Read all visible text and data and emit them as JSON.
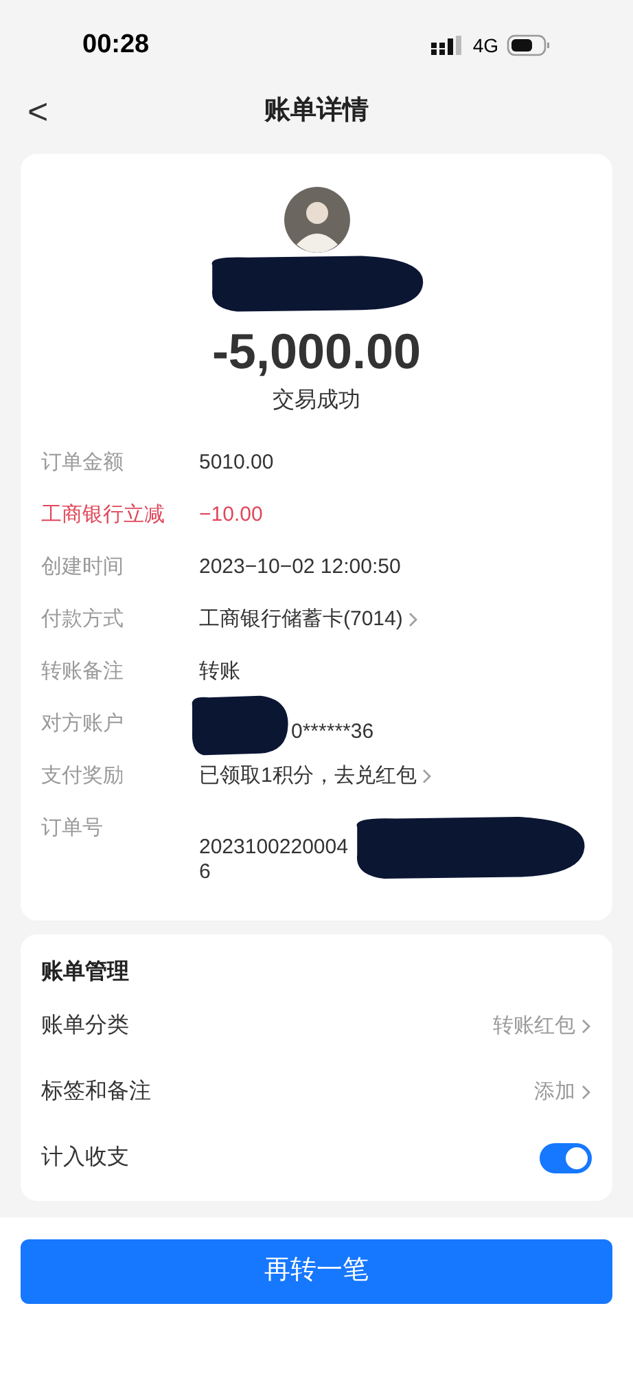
{
  "status_bar": {
    "time": "00:28",
    "network": "4G"
  },
  "header": {
    "title": "账单详情",
    "back": "<"
  },
  "summary": {
    "amount": "-5,000.00",
    "status": "交易成功"
  },
  "details": [
    {
      "label": "订单金额",
      "value": "5010.00",
      "kind": "plain"
    },
    {
      "label": "工商银行立减",
      "value": "−10.00",
      "kind": "discount"
    },
    {
      "label": "创建时间",
      "value": "2023−10−02 12:00:50",
      "kind": "plain"
    },
    {
      "label": "付款方式",
      "value": "工商银行储蓄卡(7014)",
      "kind": "link"
    },
    {
      "label": "转账备注",
      "value": "转账",
      "kind": "plain"
    },
    {
      "label": "对方账户",
      "value": "0******36",
      "kind": "redacted"
    },
    {
      "label": "支付奖励",
      "value": "已领取1积分，去兑红包",
      "kind": "link"
    },
    {
      "label": "订单号",
      "value": "2023100220004",
      "value_line_2": "6",
      "kind": "redacted_order"
    }
  ],
  "management": {
    "title": "账单管理",
    "rows": [
      {
        "label": "账单分类",
        "value": "转账红包",
        "kind": "link"
      },
      {
        "label": "标签和备注",
        "value": "添加",
        "kind": "link"
      },
      {
        "label": "计入收支",
        "kind": "toggle",
        "on": true
      }
    ]
  },
  "action_button": "再转一笔"
}
